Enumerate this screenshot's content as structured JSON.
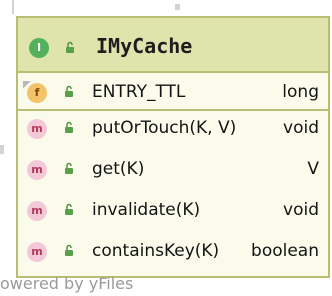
{
  "class_box": {
    "badge": "I",
    "title": "IMyCache",
    "colors": {
      "border": "#b8bf72",
      "header": "#dfe4ad",
      "body": "#fbfbec",
      "badge": "#54b15b"
    }
  },
  "fields": [
    {
      "marker": "f",
      "icon": "field-icon",
      "name": "ENTRY_TTL",
      "type": "long"
    }
  ],
  "methods": [
    {
      "marker": "m",
      "icon": "method-icon",
      "name": "putOrTouch(K, V)",
      "type": "void"
    },
    {
      "marker": "m",
      "icon": "method-icon",
      "name": "get(K)",
      "type": "V"
    },
    {
      "marker": "m",
      "icon": "method-icon",
      "name": "invalidate(K)",
      "type": "void"
    },
    {
      "marker": "m",
      "icon": "method-icon",
      "name": "containsKey(K)",
      "type": "boolean"
    }
  ],
  "watermark": "owered by yFiles"
}
